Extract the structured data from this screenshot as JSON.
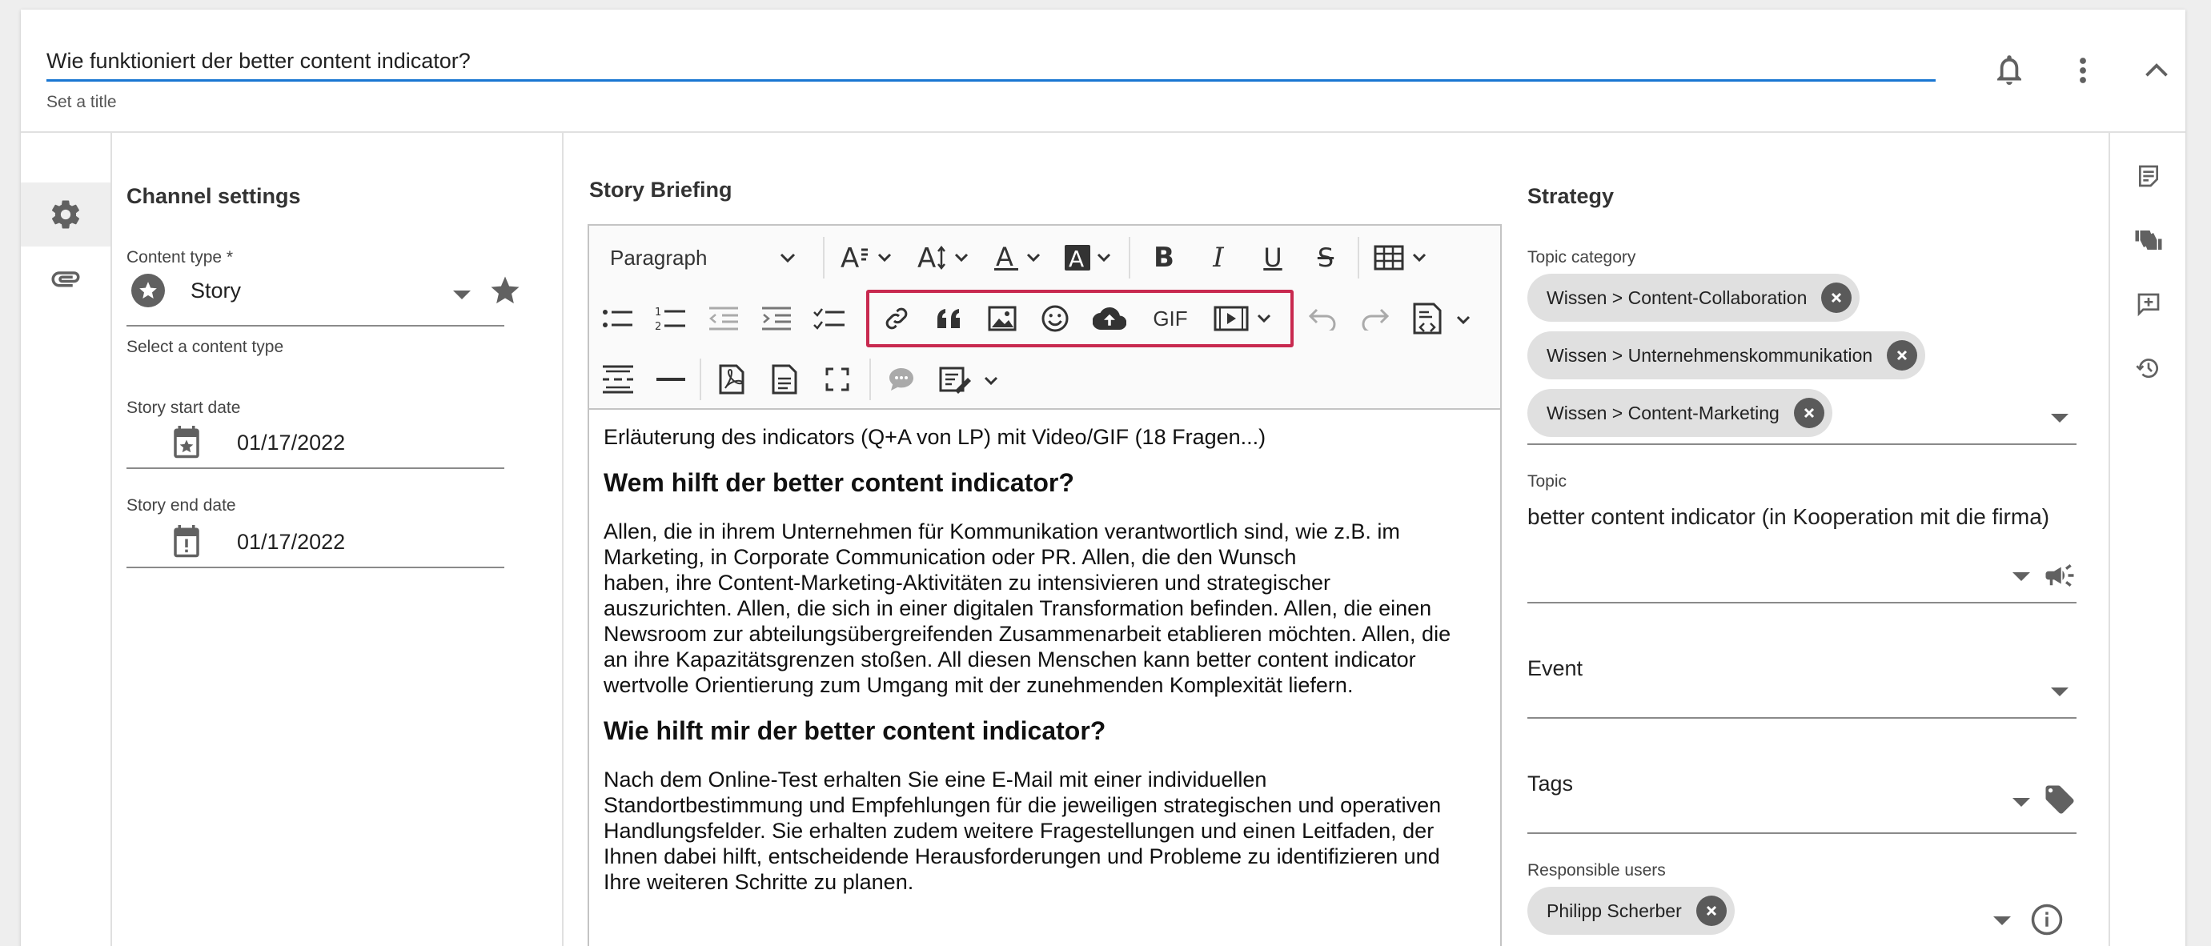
{
  "header": {
    "title_value": "Wie funktioniert der better content indicator?",
    "title_hint": "Set a title",
    "icons": [
      "bell-icon",
      "more-vert-icon",
      "collapse-icon"
    ]
  },
  "rail": {
    "items": [
      {
        "icon": "settings-gear-icon",
        "active": true
      },
      {
        "icon": "attachment-icon",
        "active": false
      }
    ]
  },
  "channel": {
    "title": "Channel settings",
    "content_type": {
      "label": "Content type *",
      "value": "Story",
      "hint": "Select a content type"
    },
    "start_date": {
      "label": "Story start date",
      "value": "01/17/2022"
    },
    "end_date": {
      "label": "Story end date",
      "value": "01/17/2022"
    }
  },
  "briefing": {
    "title": "Story Briefing",
    "toolbar": {
      "paragraph_label": "Paragraph",
      "gif_label": "GIF"
    },
    "content": {
      "p1": "Erläuterung des indicators (Q+A von LP) mit Video/GIF (18 Fragen...)",
      "h1": "Wem hilft der better content indicator?",
      "p2_line1": "Allen, die in ihrem Unternehmen für Kommunikation verantwortlich sind, wie z.B. im",
      "p2_line2": "Marketing, in Corporate Communication oder PR. Allen, die den Wunsch",
      "p2_line3": "haben, ihre Content-Marketing-Aktivitäten zu intensivieren und strategischer",
      "p2_line4": "auszurichten. Allen, die sich in einer digitalen Transformation befinden. Allen, die einen",
      "p2_line5": "Newsroom zur abteilungsübergreifenden Zusammenarbeit etablieren möchten. Allen, die",
      "p2_line6": "an ihre Kapazitätsgrenzen stoßen. All diesen Menschen kann better content indicator",
      "p2_line7": "wertvolle Orientierung zum Umgang mit der zunehmenden Komplexität liefern.",
      "h2": "Wie hilft mir der better content indicator?",
      "p3_line1": "Nach dem Online-Test erhalten Sie eine E-Mail mit einer individuellen",
      "p3_line2": "Standortbestimmung und Empfehlungen für die jeweiligen strategischen und operativen",
      "p3_line3": "Handlungsfelder. Sie erhalten zudem weitere Fragestellungen und einen Leitfaden, der",
      "p3_line4": "Ihnen dabei hilft, entscheidende Herausforderungen und Probleme zu identifizieren und",
      "p3_line5": "Ihre weiteren Schritte zu planen."
    }
  },
  "strategy": {
    "title": "Strategy",
    "topic_category": {
      "label": "Topic category",
      "chips": [
        "Wissen > Content-Collaboration",
        "Wissen > Unternehmenskommunikation",
        "Wissen > Content-Marketing"
      ]
    },
    "topic": {
      "label": "Topic",
      "value": "better content indicator (in Kooperation mit die firma)"
    },
    "event": {
      "label": "Event"
    },
    "tags": {
      "label": "Tags"
    },
    "responsible": {
      "label": "Responsible users",
      "chips": [
        "Philipp Scherber"
      ]
    }
  },
  "right_rail": {
    "icons": [
      "notes-icon",
      "thumbs-icon",
      "add-comment-icon",
      "history-icon"
    ]
  },
  "colors": {
    "accent_blue": "#1976d2",
    "highlight_red": "#c8294f",
    "chip_bg": "#e0e0e0",
    "icon_grey": "#616161"
  }
}
